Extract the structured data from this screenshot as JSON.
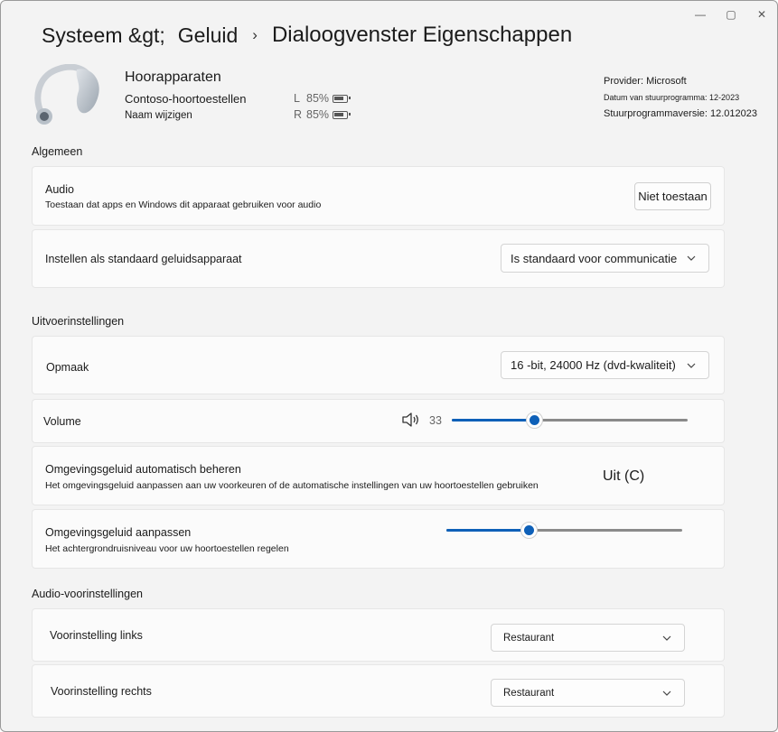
{
  "window": {
    "controls": {
      "minimize": "—",
      "maximize": "▢",
      "close": "✕"
    }
  },
  "breadcrumb": {
    "first": "Systeem &gt;",
    "second": "Geluid",
    "separator": "›",
    "current": "Dialoogvenster Eigenschappen"
  },
  "device": {
    "name": "Hoorapparaten",
    "model": "Contoso-hoortoestellen",
    "rename": "Naam wijzigen",
    "battery_left": {
      "side": "L",
      "percent": "85%"
    },
    "battery_right": {
      "side": "R",
      "percent": "85%"
    }
  },
  "driver": {
    "provider": "Provider: Microsoft",
    "date": "Datum van stuurprogramma: 12-2023",
    "version": "Stuurprogrammaversie: 12.012023"
  },
  "sections": {
    "general": "Algemeen",
    "output": "Uitvoerinstellingen",
    "presets": "Audio-voorinstellingen"
  },
  "audio": {
    "title": "Audio",
    "subtitle": "Toestaan dat apps en Windows dit apparaat gebruiken voor audio",
    "button": "Niet toestaan"
  },
  "default_device": {
    "title": "Instellen als standaard geluidsapparaat",
    "value": "Is standaard voor communicatie"
  },
  "format": {
    "title": "Opmaak",
    "value": "16 -bit, 24000 Hz (dvd-kwaliteit)"
  },
  "volume": {
    "title": "Volume",
    "value": "33",
    "fraction": 0.35
  },
  "ambient_auto": {
    "title": "Omgevingsgeluid automatisch beheren",
    "subtitle": "Het omgevingsgeluid aanpassen aan uw voorkeuren of de automatische instellingen van uw hoortoestellen gebruiken",
    "state": "Uit (C)"
  },
  "ambient_adjust": {
    "title": "Omgevingsgeluid aanpassen",
    "subtitle": "Het achtergrondruisniveau voor uw hoortoestellen regelen",
    "fraction": 0.35
  },
  "preset_left": {
    "title": "Voorinstelling links",
    "value": "Restaurant"
  },
  "preset_right": {
    "title": "Voorinstelling rechts",
    "value": "Restaurant"
  },
  "icons": {
    "speaker": "speaker-icon",
    "chevron": "chevron-down-icon",
    "battery": "battery-icon",
    "hearing_aid": "hearing-aid-icon"
  }
}
